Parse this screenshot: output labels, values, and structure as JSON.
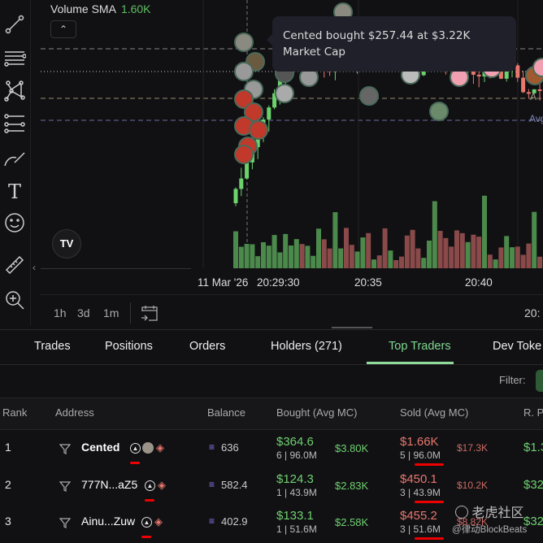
{
  "chart": {
    "indicator_label": "Volume SMA",
    "indicator_value": "1.60K",
    "tooltip": "Cented bought $257.44 at $3.22K Market Cap",
    "axis_labels": [
      "11 Mar '26",
      "20:29:30",
      "20:35",
      "20:40",
      "20:"
    ],
    "ranges": [
      "1h",
      "3d",
      "1m"
    ],
    "logo": "TV",
    "price_line_labels": [
      "A",
      "Avg"
    ],
    "colors": {
      "up": "#6cd36c",
      "down": "#e8776d"
    }
  },
  "toolbar": [
    "trend-line",
    "horizontal-lines",
    "pattern",
    "fib",
    "brush",
    "text",
    "emoji",
    "ruler",
    "zoom"
  ],
  "tabs": [
    {
      "label": "Trades"
    },
    {
      "label": "Positions"
    },
    {
      "label": "Orders"
    },
    {
      "label": "Holders (271)"
    },
    {
      "label": "Top Traders",
      "active": true
    },
    {
      "label": "Dev Toke"
    }
  ],
  "filter_label": "Filter:",
  "table": {
    "headers": [
      "Rank",
      "Address",
      "Balance",
      "Bought (Avg MC)",
      "Sold (Avg MC)",
      "R. P"
    ],
    "rows": [
      {
        "rank": "1",
        "address": "Cented",
        "balance": "636",
        "bought": "$364.6",
        "bought_sub": "6 | 96.0M",
        "bought_mc": "$3.80K",
        "sold": "$1.66K",
        "sold_sub": "5 | 96.0M",
        "sold_mc": "$17.3K",
        "rp": "$1.3"
      },
      {
        "rank": "2",
        "address": "777N...aZ5",
        "balance": "582.4",
        "bought": "$124.3",
        "bought_sub": "1 | 43.9M",
        "bought_mc": "$2.83K",
        "sold": "$450.1",
        "sold_sub": "3 | 43.9M",
        "sold_mc": "$10.2K",
        "rp": "$32"
      },
      {
        "rank": "3",
        "address": "Ainu...Zuw",
        "balance": "402.9",
        "bought": "$133.1",
        "bought_sub": "1 | 51.6M",
        "bought_mc": "$2.58K",
        "sold": "$455.2",
        "sold_sub": "3 | 51.6M",
        "sold_mc": "$8.82K",
        "rp": "$32"
      }
    ]
  },
  "watermark": {
    "line1": "老虎社区",
    "line2": "@律动BlockBeats"
  }
}
